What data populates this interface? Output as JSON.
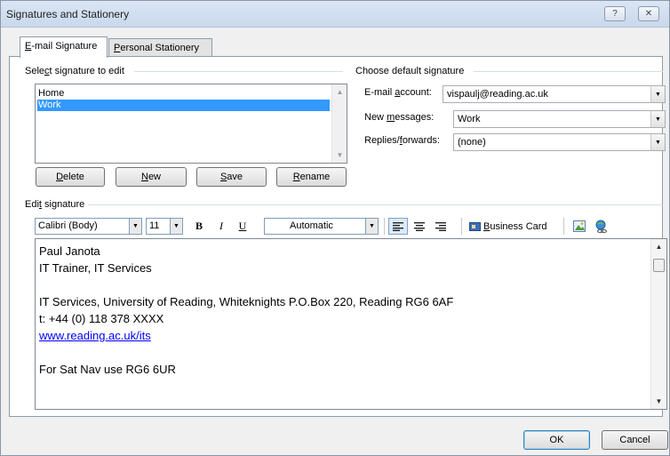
{
  "window": {
    "title": "Signatures and Stationery",
    "help_glyph": "?",
    "close_glyph": "✕"
  },
  "tabs": [
    {
      "pre": "",
      "key": "E",
      "post": "-mail Signature"
    },
    {
      "pre": "",
      "key": "P",
      "post": "ersonal Stationery"
    }
  ],
  "select_signature": {
    "label_pre": "Sele",
    "label_key": "c",
    "label_post": "t signature to edit",
    "items": [
      "Home",
      "Work"
    ],
    "selected_index": 1
  },
  "signature_buttons": {
    "delete": {
      "key": "D",
      "post": "elete"
    },
    "new": {
      "key": "N",
      "post": "ew"
    },
    "save": {
      "key": "S",
      "post": "ave"
    },
    "rename": {
      "key": "R",
      "post": "ename"
    }
  },
  "default_signature": {
    "label": "Choose default signature",
    "email_account": {
      "label_pre": "E-mail ",
      "label_key": "a",
      "label_post": "ccount:",
      "value": "vispaulj@reading.ac.uk"
    },
    "new_messages": {
      "label_pre": "New ",
      "label_key": "m",
      "label_post": "essages:",
      "value": "Work"
    },
    "replies": {
      "label_pre": "Replies/",
      "label_key": "f",
      "label_post": "orwards:",
      "value": "(none)"
    }
  },
  "edit_signature": {
    "label_pre": "Edi",
    "label_key": "t",
    "label_post": " signature",
    "font": "Calibri (Body)",
    "size": "11",
    "bold": "B",
    "italic": "I",
    "underline": "U",
    "color": "Automatic",
    "business_card": {
      "key": "B",
      "post": "usiness Card"
    },
    "lines": [
      "Paul Janota",
      "IT Trainer, IT Services",
      "",
      "IT Services, University of Reading, Whiteknights P.O.Box 220, Reading RG6 6AF",
      "t: +44 (0) 118 378 XXXX",
      "www.reading.ac.uk/its",
      "",
      "For Sat Nav use RG6 6UR"
    ],
    "link_line_index": 5
  },
  "footer": {
    "ok": "OK",
    "cancel": "Cancel"
  },
  "colors": {
    "selection": "#3399ff",
    "link": "#0000ff",
    "titlebar": "#dbe6f4"
  },
  "icons": [
    "help-icon",
    "close-icon",
    "dropdown-arrow-icon",
    "align-left-icon",
    "align-center-icon",
    "align-right-icon",
    "business-card-icon",
    "insert-picture-icon",
    "hyperlink-icon"
  ]
}
